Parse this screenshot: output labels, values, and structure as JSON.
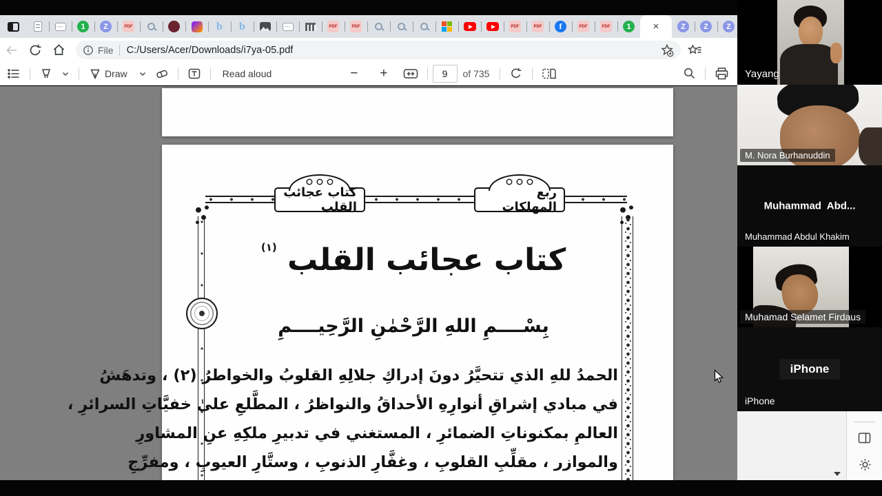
{
  "browser": {
    "tab_strip": {
      "tabs": [
        "document",
        "card",
        "one",
        "z",
        "pdf",
        "search",
        "maroon",
        "gradient",
        "b",
        "b",
        "image",
        "card",
        "bank",
        "pdf",
        "pdf",
        "search",
        "search",
        "search",
        "microsoft",
        "youtube",
        "youtube",
        "pdf",
        "pdf",
        "facebook",
        "pdf",
        "pdf",
        "one"
      ],
      "tabs_after_active": [
        "z",
        "z",
        "z",
        "z"
      ],
      "active_tab_close": "×",
      "favicon_letters": {
        "one": "1",
        "z": "Z",
        "facebook": "f",
        "b": "b",
        "pdf": "PDF",
        "card": "···"
      }
    },
    "address_bar": {
      "info_label": "File",
      "url": "C:/Users/Acer/Downloads/i7ya-05.pdf",
      "icons": [
        "back-icon",
        "refresh-icon",
        "home-icon",
        "info-icon",
        "add-favorite-star-icon",
        "favorites-hub-icon"
      ]
    },
    "pdf_toolbar": {
      "draw_label": "Draw",
      "read_aloud_label": "Read aloud",
      "zoom_out_label": "−",
      "zoom_in_label": "+",
      "page_number": "9",
      "page_total_label": "of 735",
      "icons": [
        "contents-icon",
        "highlighter-icon",
        "chevron-down-icon",
        "pen-icon",
        "eraser-icon",
        "add-text-icon",
        "fit-width-icon",
        "rotate-icon",
        "page-view-icon",
        "search-icon",
        "print-icon"
      ]
    }
  },
  "pdf_page": {
    "header_tab_left": "كتاب عجائب القلب",
    "header_tab_right": "ربع المهلكات",
    "title": "كتاب عجائب القلب",
    "title_footnote": "(١)",
    "basmala": "بِسْــــمِ اللهِ الرَّحْمٰنِ الرَّحِيــــمِ",
    "body_lines": [
      "الحمدُ للهِ الذي تتحيَّرُ دونَ إدراكِ جلالِهِ القلوبُ والخواطرُ (٢) ، وتدهَشُ",
      "في مبادي إشراقِ أنوارِهِ الأحداقُ والنواظرُ ، المطَّلعِ علىٰ خفيَّاتِ السرائرِ ،",
      "العالمِ بمكنوناتِ الضمائرِ ، المستغني في تدبيرِ ملكِهِ عنِ المشاورِ",
      "والموازر ، مقلِّبِ القلوبِ ، وغفَّارِ الذنوبِ ، وستَّارِ العيوبِ ، ومفرِّجِ"
    ]
  },
  "meeting_panel": {
    "participants": [
      {
        "label": "Yayang"
      },
      {
        "label": "M. Nora Burhanuddin"
      },
      {
        "display_name": "Muhammad  Abd...",
        "label": "Muhammad Abdul Khakim"
      },
      {
        "label": "Muhamad Selamet Firdaus"
      },
      {
        "display_name": "iPhone",
        "label": "iPhone"
      }
    ]
  }
}
